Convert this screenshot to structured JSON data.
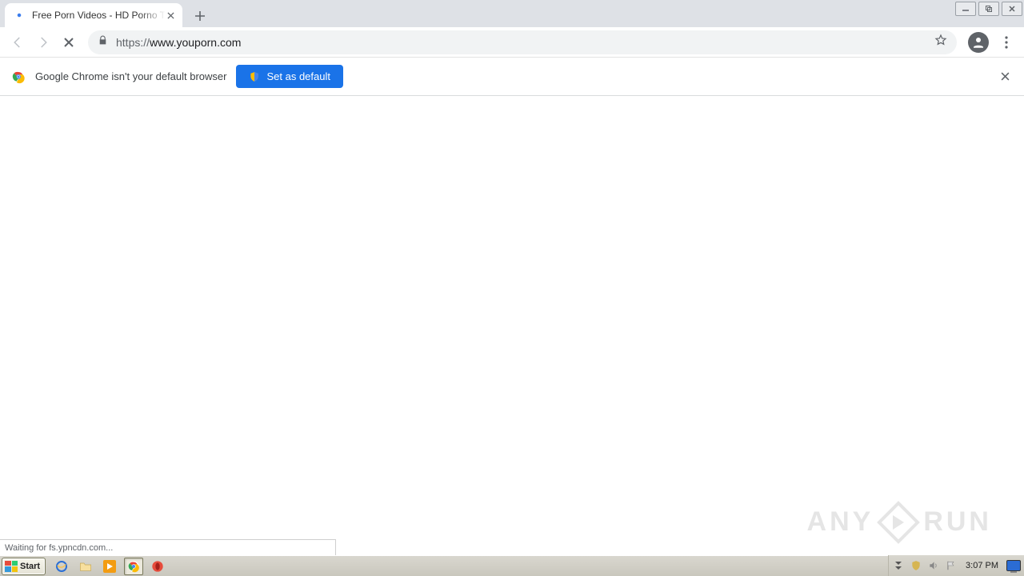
{
  "tab": {
    "title": "Free Porn Videos - HD Porno Tube &"
  },
  "address": {
    "protocol": "https://",
    "host": "www.youporn.com"
  },
  "infobar": {
    "message": "Google Chrome isn't your default browser",
    "button": "Set as default"
  },
  "status": "Waiting for fs.ypncdn.com...",
  "watermark": {
    "left": "ANY",
    "right": "RUN"
  },
  "taskbar": {
    "start": "Start",
    "clock": "3:07 PM"
  }
}
